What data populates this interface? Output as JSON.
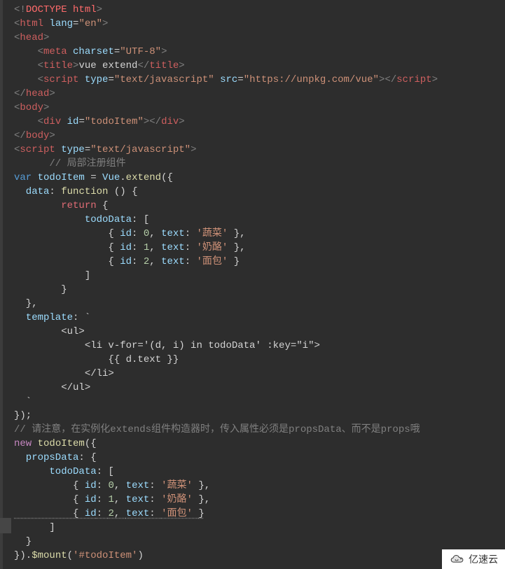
{
  "lines": [
    [
      [
        "<!",
        "angle"
      ],
      [
        "DOCTYPE html",
        "doctype"
      ],
      [
        ">",
        "angle"
      ]
    ],
    [
      [
        "<",
        "angle"
      ],
      [
        "html ",
        "redtag"
      ],
      [
        "lang",
        "attr2"
      ],
      [
        "=",
        "punct"
      ],
      [
        "\"en\"",
        "str"
      ],
      [
        ">",
        "angle"
      ]
    ],
    [
      [
        "<",
        "angle"
      ],
      [
        "head",
        "redtag"
      ],
      [
        ">",
        "angle"
      ]
    ],
    [
      [
        "    <",
        "angle"
      ],
      [
        "meta ",
        "redtag"
      ],
      [
        "charset",
        "attr2"
      ],
      [
        "=",
        "punct"
      ],
      [
        "\"UTF-8\"",
        "str"
      ],
      [
        ">",
        "angle"
      ]
    ],
    [
      [
        "    <",
        "angle"
      ],
      [
        "title",
        "redtag"
      ],
      [
        ">",
        "angle"
      ],
      [
        "vue extend",
        "plain"
      ],
      [
        "</",
        "angle"
      ],
      [
        "title",
        "redtag"
      ],
      [
        ">",
        "angle"
      ]
    ],
    [
      [
        "    <",
        "angle"
      ],
      [
        "script ",
        "redtag"
      ],
      [
        "type",
        "attr2"
      ],
      [
        "=",
        "punct"
      ],
      [
        "\"text/javascript\" ",
        "str"
      ],
      [
        "src",
        "attr2"
      ],
      [
        "=",
        "punct"
      ],
      [
        "\"https://unpkg.com/vue\"",
        "str"
      ],
      [
        "></",
        "angle"
      ],
      [
        "script",
        "redtag"
      ],
      [
        ">",
        "angle"
      ]
    ],
    [
      [
        "</",
        "angle"
      ],
      [
        "head",
        "redtag"
      ],
      [
        ">",
        "angle"
      ]
    ],
    [
      [
        "<",
        "angle"
      ],
      [
        "body",
        "redtag"
      ],
      [
        ">",
        "angle"
      ]
    ],
    [
      [
        "    <",
        "angle"
      ],
      [
        "div ",
        "redtag"
      ],
      [
        "id",
        "attr2"
      ],
      [
        "=",
        "punct"
      ],
      [
        "\"todoItem\"",
        "str"
      ],
      [
        "></",
        "angle"
      ],
      [
        "div",
        "redtag"
      ],
      [
        ">",
        "angle"
      ]
    ],
    [
      [
        "</",
        "angle"
      ],
      [
        "body",
        "redtag"
      ],
      [
        ">",
        "angle"
      ]
    ],
    [
      [
        "<",
        "angle"
      ],
      [
        "script ",
        "redtag"
      ],
      [
        "type",
        "attr2"
      ],
      [
        "=",
        "punct"
      ],
      [
        "\"text/javascript\"",
        "str"
      ],
      [
        ">",
        "angle"
      ]
    ],
    [
      [
        "      // ",
        "comment2"
      ],
      [
        "局部注册组件",
        "comment2"
      ]
    ],
    [
      [
        "var ",
        "kw"
      ],
      [
        "todoItem ",
        "ident"
      ],
      [
        "= ",
        "punct"
      ],
      [
        "Vue",
        "ident"
      ],
      [
        ".",
        "punct"
      ],
      [
        "extend",
        "func"
      ],
      [
        "({",
        "punct"
      ]
    ],
    [
      [
        "  data",
        "prop"
      ],
      [
        ": ",
        "punct"
      ],
      [
        "function ",
        "func"
      ],
      [
        "() {",
        "punct"
      ]
    ],
    [
      [
        "        return ",
        "pink"
      ],
      [
        "{",
        "punct"
      ]
    ],
    [
      [
        "            todoData",
        "ident"
      ],
      [
        ": [",
        "punct"
      ]
    ],
    [
      [
        "                { ",
        "punct"
      ],
      [
        "id",
        "ident"
      ],
      [
        ": ",
        "punct"
      ],
      [
        "0",
        "num"
      ],
      [
        ", ",
        "punct"
      ],
      [
        "text",
        "ident"
      ],
      [
        ": ",
        "punct"
      ],
      [
        "'蔬菜' ",
        "str"
      ],
      [
        "},",
        "punct"
      ]
    ],
    [
      [
        "                { ",
        "punct"
      ],
      [
        "id",
        "ident"
      ],
      [
        ": ",
        "punct"
      ],
      [
        "1",
        "num"
      ],
      [
        ", ",
        "punct"
      ],
      [
        "text",
        "ident"
      ],
      [
        ": ",
        "punct"
      ],
      [
        "'奶酪' ",
        "str"
      ],
      [
        "},",
        "punct"
      ]
    ],
    [
      [
        "                { ",
        "punct"
      ],
      [
        "id",
        "ident"
      ],
      [
        ": ",
        "punct"
      ],
      [
        "2",
        "num"
      ],
      [
        ", ",
        "punct"
      ],
      [
        "text",
        "ident"
      ],
      [
        ": ",
        "punct"
      ],
      [
        "'面包' ",
        "str"
      ],
      [
        "}",
        "punct"
      ]
    ],
    [
      [
        "            ]",
        "punct"
      ]
    ],
    [
      [
        "        }",
        "punct"
      ]
    ],
    [
      [
        "  },",
        "punct"
      ]
    ],
    [
      [
        "  template",
        "ident"
      ],
      [
        ": `",
        "punct"
      ]
    ],
    [
      [
        "        <ul>",
        "templ"
      ]
    ],
    [
      [
        "            <li v-for='(d, i) in todoData' :key=\"i\">",
        "templ"
      ]
    ],
    [
      [
        "                {{ d.text }}",
        "templ"
      ]
    ],
    [
      [
        "            </li>",
        "templ"
      ]
    ],
    [
      [
        "        </ul>",
        "templ"
      ]
    ],
    [
      [
        "  `",
        "punct"
      ]
    ],
    [
      [
        "});",
        "punct"
      ]
    ],
    [
      [
        "// 请注意，在实例化extends组件构造器时，传入属性必须是propsData、而不是props哦",
        "comment2"
      ]
    ],
    [
      [
        "new ",
        "new"
      ],
      [
        "todoItem",
        "func"
      ],
      [
        "({",
        "punct"
      ]
    ],
    [
      [
        "  propsData",
        "ident"
      ],
      [
        ": {",
        "punct"
      ]
    ],
    [
      [
        "      todoData",
        "ident"
      ],
      [
        ": [",
        "punct"
      ]
    ],
    [
      [
        "          { ",
        "punct"
      ],
      [
        "id",
        "ident"
      ],
      [
        ": ",
        "punct"
      ],
      [
        "0",
        "num"
      ],
      [
        ", ",
        "punct"
      ],
      [
        "text",
        "ident"
      ],
      [
        ": ",
        "punct"
      ],
      [
        "'蔬菜' ",
        "str"
      ],
      [
        "},",
        "punct"
      ]
    ],
    [
      [
        "          { ",
        "punct"
      ],
      [
        "id",
        "ident"
      ],
      [
        ": ",
        "punct"
      ],
      [
        "1",
        "num"
      ],
      [
        ", ",
        "punct"
      ],
      [
        "text",
        "ident"
      ],
      [
        ": ",
        "punct"
      ],
      [
        "'奶酪' ",
        "str"
      ],
      [
        "},",
        "punct"
      ]
    ],
    [
      [
        "          { ",
        "punct-u"
      ],
      [
        "id",
        "ident-u"
      ],
      [
        ": ",
        "punct-u"
      ],
      [
        "2",
        "num-u"
      ],
      [
        ", ",
        "punct-u"
      ],
      [
        "text",
        "ident-u"
      ],
      [
        ": ",
        "punct-u"
      ],
      [
        "'面包' ",
        "str-u"
      ],
      [
        "}",
        "punct-u"
      ]
    ],
    [
      [
        "      ]",
        "punct"
      ]
    ],
    [
      [
        "  }",
        "punct"
      ]
    ],
    [
      [
        "}).",
        "punct"
      ],
      [
        "$mount",
        "dollar"
      ],
      [
        "(",
        "punct"
      ],
      [
        "'#todoItem'",
        "str"
      ],
      [
        ")",
        "punct"
      ]
    ]
  ],
  "watermark": "亿速云",
  "colormap": {
    "angle": "c-angle",
    "doctype": "c-doctype",
    "redtag": "c-redtag",
    "attr2": "c-attr2",
    "punct": "c-punct",
    "str": "c-str",
    "plain": "c-plain",
    "kw": "c-kw",
    "pink": "c-pink",
    "func": "c-func",
    "ident": "c-ident",
    "comment2": "c-comment2",
    "num": "c-num",
    "prop": "c-prop",
    "templ": "c-templ",
    "new": "c-new",
    "dollar": "c-dollar"
  }
}
